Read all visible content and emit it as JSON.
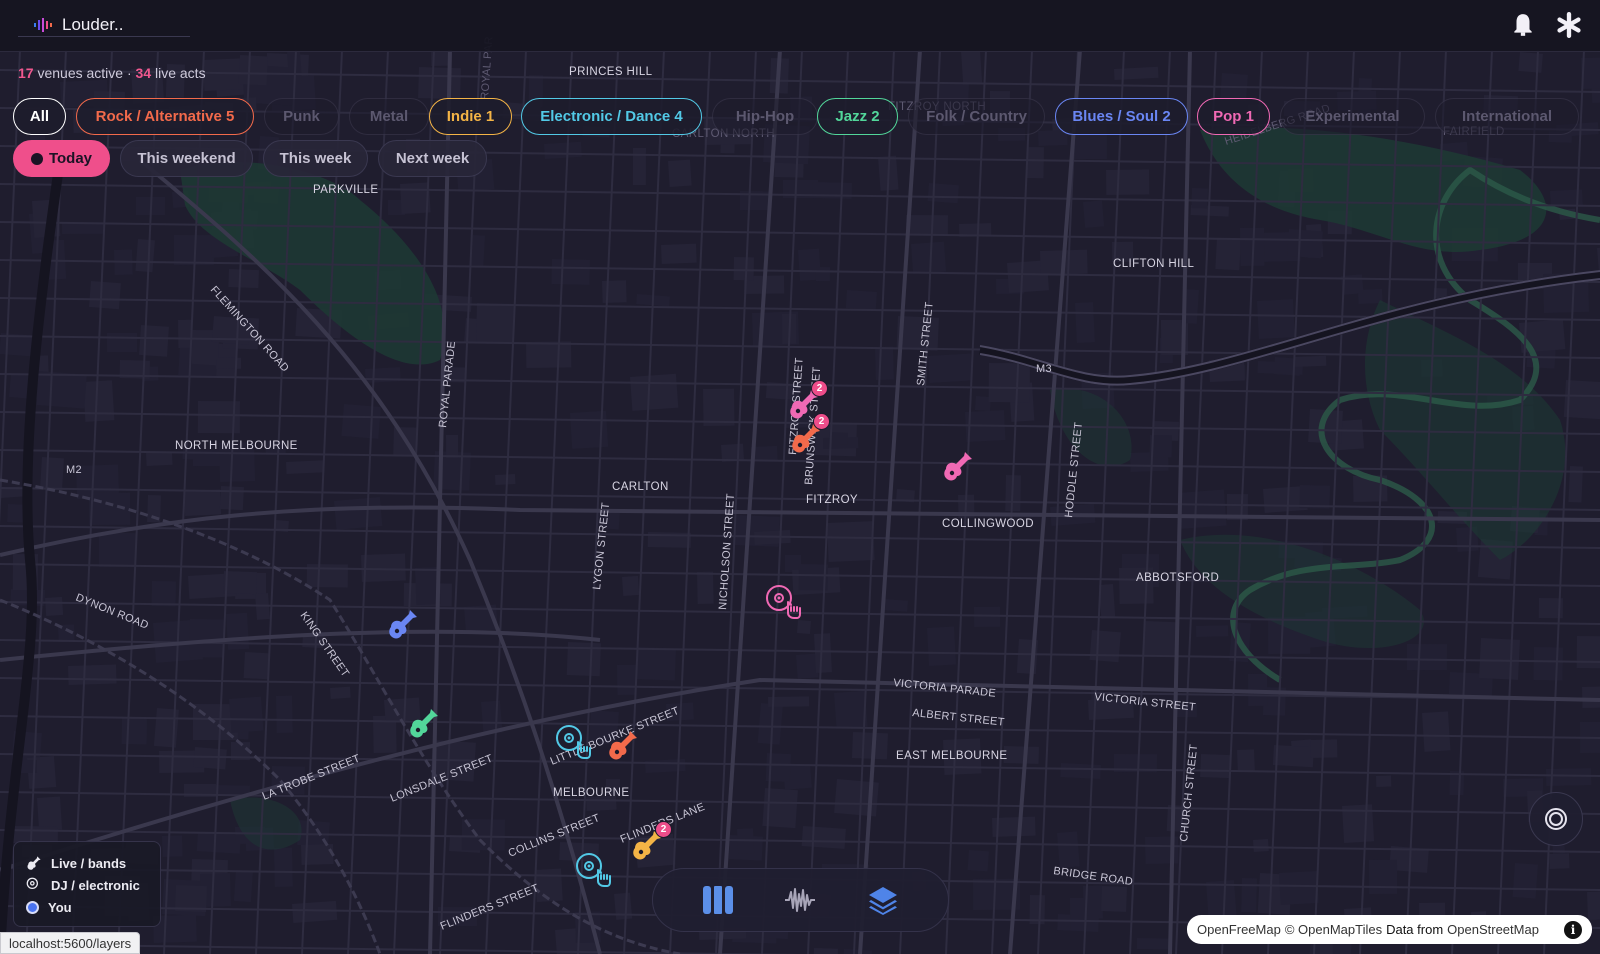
{
  "app": {
    "title": "Louder.."
  },
  "topbar": {
    "notification_icon": "bell-icon",
    "settings_icon": "asterisk-icon"
  },
  "stats": {
    "venues_count": "17",
    "venues_label": "venues active",
    "separator": "·",
    "acts_count": "34",
    "acts_label": "live acts"
  },
  "genres": [
    {
      "label": "All",
      "color": "#ffffff",
      "active": true
    },
    {
      "label": "Rock / Alternative 5",
      "color": "#f26a4b",
      "active": true
    },
    {
      "label": "Punk",
      "color": "#5c586f",
      "active": false
    },
    {
      "label": "Metal",
      "color": "#5c586f",
      "active": false
    },
    {
      "label": "Indie 1",
      "color": "#f4b446",
      "active": true
    },
    {
      "label": "Electronic / Dance 4",
      "color": "#52c9e6",
      "active": true
    },
    {
      "label": "Hip-Hop",
      "color": "#5c586f",
      "active": false
    },
    {
      "label": "Jazz 2",
      "color": "#52d69a",
      "active": true
    },
    {
      "label": "Folk / Country",
      "color": "#5c586f",
      "active": false
    },
    {
      "label": "Blues / Soul 2",
      "color": "#6a86f3",
      "active": true
    },
    {
      "label": "Pop 1",
      "color": "#f069b4",
      "active": true
    },
    {
      "label": "Experimental",
      "color": "#5c586f",
      "active": false
    },
    {
      "label": "International",
      "color": "#5c586f",
      "active": false
    }
  ],
  "dates": [
    {
      "label": "Today",
      "active": true
    },
    {
      "label": "This weekend",
      "active": false
    },
    {
      "label": "This week",
      "active": false
    },
    {
      "label": "Next week",
      "active": false
    }
  ],
  "map_labels": {
    "suburbs": [
      "PRINCES HILL",
      "CARLTON NORTH",
      "FITZROY NORTH",
      "PARKVILLE",
      "CLIFTON HILL",
      "NORTH MELBOURNE",
      "CARLTON",
      "FITZROY",
      "COLLINGWOOD",
      "ABBOTSFORD",
      "EAST MELBOURNE",
      "MELBOURNE",
      "FAIRFIELD"
    ],
    "streets": [
      "ROYAL PARADE",
      "FLEMINGTON ROAD",
      "DYNON ROAD",
      "KING STREET",
      "LA TROBE STREET",
      "LONSDALE STREET",
      "COLLINS STREET",
      "FLINDERS STREET",
      "FLINDERS LANE",
      "LYGON STREET",
      "NICHOLSON STREET",
      "FITZROY STREET",
      "BRUNSWICK STREET",
      "SMITH STREET",
      "HODDLE STREET",
      "CHURCH STREET",
      "VICTORIA PARADE",
      "ALBERT STREET",
      "VICTORIA STREET",
      "BRIDGE ROAD",
      "HEIDELBERG ROAD",
      "M3",
      "M2",
      "LITTLE BOURKE STREET",
      "ROYAL PAR"
    ]
  },
  "markers": [
    {
      "type": "guitar",
      "genre": "pop",
      "color": "#f069b4",
      "count": "2"
    },
    {
      "type": "guitar",
      "genre": "rock",
      "color": "#f26a4b",
      "count": "2"
    },
    {
      "type": "guitar",
      "genre": "pop",
      "color": "#f069b4",
      "count": ""
    },
    {
      "type": "dj",
      "genre": "pop",
      "color": "#f069b4",
      "count": ""
    },
    {
      "type": "guitar",
      "genre": "blues",
      "color": "#6a86f3",
      "count": ""
    },
    {
      "type": "guitar",
      "genre": "jazz",
      "color": "#52d69a",
      "count": ""
    },
    {
      "type": "dj",
      "genre": "electronic",
      "color": "#52c9e6",
      "count": ""
    },
    {
      "type": "guitar",
      "genre": "rock",
      "color": "#f26a4b",
      "count": ""
    },
    {
      "type": "guitar",
      "genre": "indie",
      "color": "#f4b446",
      "count": "2"
    },
    {
      "type": "dj",
      "genre": "electronic",
      "color": "#52c9e6",
      "count": ""
    }
  ],
  "legend": [
    {
      "label": "Live / bands",
      "icon": "guitar-icon"
    },
    {
      "label": "DJ / electronic",
      "icon": "turntable-icon"
    },
    {
      "label": "You",
      "icon": "location-dot-icon"
    }
  ],
  "toolbar": [
    {
      "name": "map-view",
      "icon": "map-icon",
      "color": "#5b8fe8"
    },
    {
      "name": "waveform",
      "icon": "waveform-icon",
      "color": "#a8a5b8"
    },
    {
      "name": "layers",
      "icon": "layers-icon",
      "color": "#4f84e8"
    }
  ],
  "locate": {
    "icon": "locate-icon"
  },
  "attribution": {
    "part1": "OpenFreeMap",
    "part2": "© OpenMapTiles",
    "part3": "Data from",
    "part4": "OpenStreetMap",
    "info": "i"
  },
  "statusbar": {
    "url": "localhost:5600/layers"
  }
}
